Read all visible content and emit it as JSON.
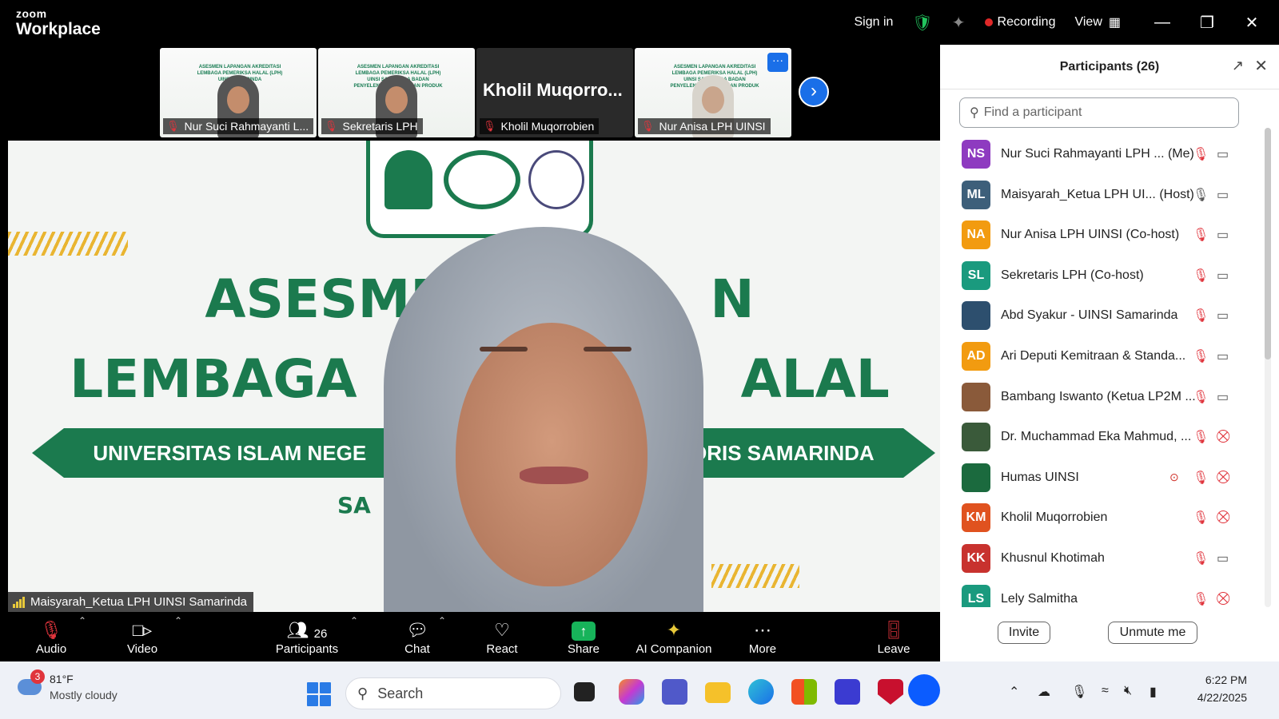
{
  "titlebar": {
    "logo_small": "zoom",
    "logo_big": "Workplace",
    "sign_in": "Sign in",
    "recording": "Recording",
    "view": "View"
  },
  "thumbnails": [
    {
      "name": "Nur Suci Rahmayanti L...",
      "type": "slide",
      "slide_text": "ASESMEN LAPANGAN AKREDITASI LEMBAGA PEMERIKSA HALAL (LPH) UINSI SAMARINDA"
    },
    {
      "name": "Sekretaris LPH",
      "type": "slide",
      "slide_text": "ASESMEN LAPANGAN AKREDITASI LEMBAGA PEMERIKSA HALAL (LPH) UINSI SAMARINDA BADAN PENYELENGGARA JAMINAN PRODUK HALAL (BPJPH)"
    },
    {
      "name": "Kholil Muqorrobien",
      "type": "name",
      "big_name": "Kholil  Muqorro..."
    },
    {
      "name": "Nur Anisa LPH UINSI",
      "type": "slide",
      "slide_text": "ASESMEN LAPANGAN AKREDITASI LEMBAGA PEMERIKSA HALAL (LPH) UINSI SAMARINDA BADAN PENYELENGGARA JAMINAN PRODUK HALAL (BPJPH)",
      "more": "···"
    }
  ],
  "main_video": {
    "slide_line1": "ASESME",
    "slide_line1b": "N",
    "slide_line2": "LEMBAGA",
    "slide_line2b": "ALAL",
    "ribbon_left": "UNIVERSITAS ISLAM NEGE",
    "ribbon_right": "IDRIS SAMARINDA",
    "slide_line4": "SA",
    "speaker_name": "Maisyarah_Ketua LPH UINSI Samarinda"
  },
  "toolbar": {
    "audio": "Audio",
    "video": "Video",
    "participants": "Participants",
    "participants_count": "26",
    "chat": "Chat",
    "react": "React",
    "share": "Share",
    "ai_companion": "AI Companion",
    "more": "More",
    "leave": "Leave"
  },
  "panel": {
    "title": "Participants (26)",
    "search_placeholder": "Find a participant",
    "invite": "Invite",
    "unmute": "Unmute me",
    "participants": [
      {
        "initials": "NS",
        "color": "#8e3bc0",
        "name": "Nur Suci Rahmayanti LPH ...  (Me)",
        "mic": "muted",
        "cam": "on"
      },
      {
        "initials": "ML",
        "color": "#3d5f7a",
        "name": "Maisyarah_Ketua LPH UI...  (Host)",
        "mic": "on",
        "cam": "on"
      },
      {
        "initials": "NA",
        "color": "#f29b10",
        "name": "Nur Anisa LPH UINSI (Co-host)",
        "mic": "muted",
        "cam": "on"
      },
      {
        "initials": "SL",
        "color": "#1a9a7e",
        "name": "Sekretaris LPH (Co-host)",
        "mic": "muted",
        "cam": "on"
      },
      {
        "initials": "",
        "color": "#2d4f6e",
        "name": "Abd Syakur - UINSI Samarinda",
        "mic": "muted",
        "cam": "on"
      },
      {
        "initials": "AD",
        "color": "#f29b10",
        "name": "Ari Deputi Kemitraan & Standa...",
        "mic": "muted",
        "cam": "on"
      },
      {
        "initials": "",
        "color": "#8a5a3a",
        "name": "Bambang Iswanto (Ketua LP2M ...",
        "mic": "muted",
        "cam": "on"
      },
      {
        "initials": "",
        "color": "#3a5a3a",
        "name": "Dr. Muchammad Eka Mahmud, ...",
        "mic": "muted",
        "cam": "off"
      },
      {
        "initials": "",
        "color": "#1b6a3e",
        "name": "Humas UINSI",
        "mic": "muted",
        "cam": "off",
        "spotlight": true
      },
      {
        "initials": "KM",
        "color": "#e0521f",
        "name": "Kholil Muqorrobien",
        "mic": "muted",
        "cam": "off"
      },
      {
        "initials": "KK",
        "color": "#c8322e",
        "name": "Khusnul Khotimah",
        "mic": "muted",
        "cam": "on"
      },
      {
        "initials": "LS",
        "color": "#1a9a7e",
        "name": "Lely Salmitha",
        "mic": "muted",
        "cam": "off"
      }
    ]
  },
  "taskbar": {
    "weather_badge": "3",
    "temperature": "81°F",
    "condition": "Mostly cloudy",
    "search": "Search",
    "time": "6:22 PM",
    "date": "4/22/2025"
  }
}
